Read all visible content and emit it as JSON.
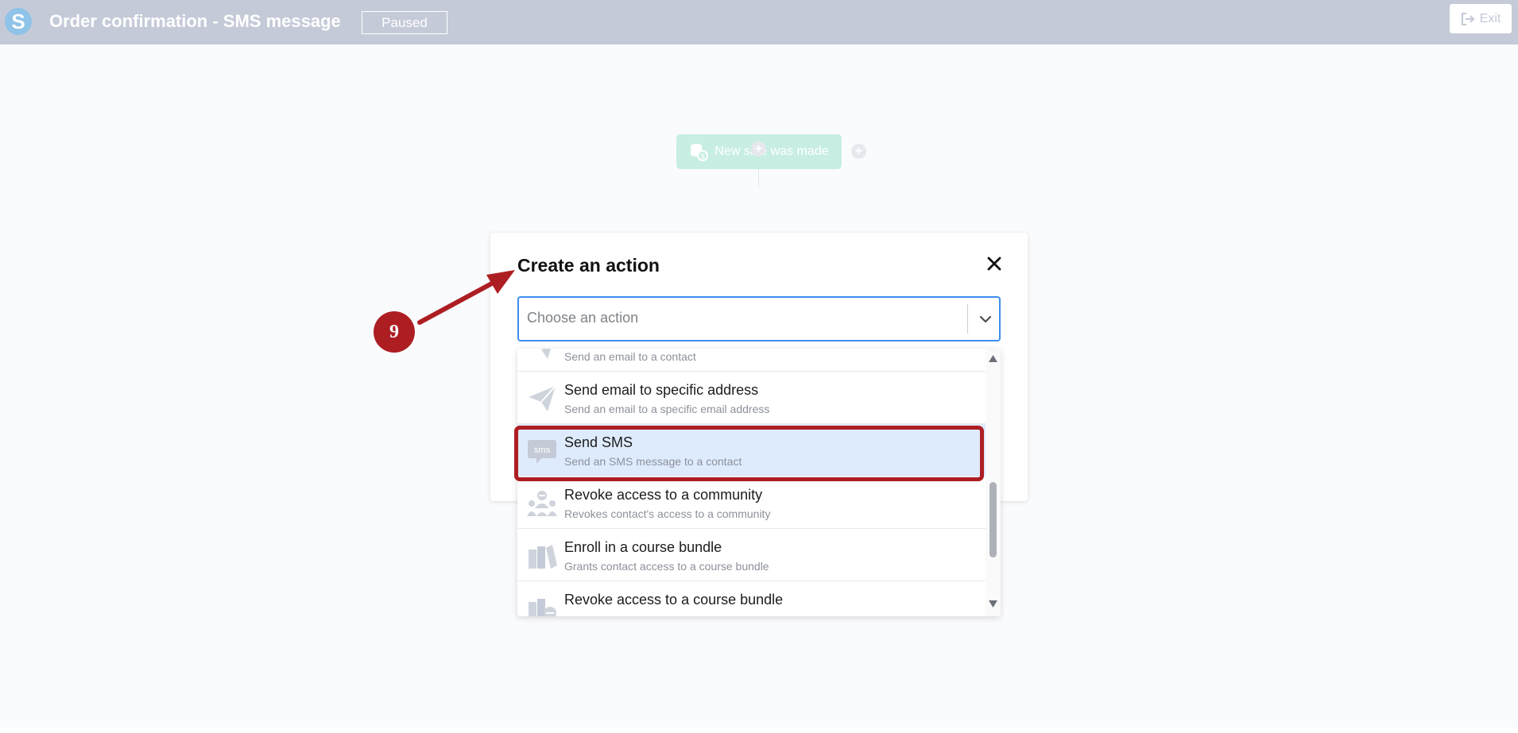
{
  "header": {
    "title": "Order confirmation - SMS message",
    "status": "Paused",
    "exit_label": "Exit"
  },
  "canvas": {
    "trigger_label": "New sale was made"
  },
  "modal": {
    "title": "Create an action",
    "select_placeholder": "Choose an action"
  },
  "menu": {
    "items": [
      {
        "label": "",
        "desc": "Send an email to a contact",
        "icon": "paper-plane-icon"
      },
      {
        "label": "Send email to specific address",
        "desc": "Send an email to a specific email address",
        "icon": "paper-plane-icon"
      },
      {
        "label": "Send SMS",
        "desc": "Send an SMS message to a contact",
        "icon": "sms-icon"
      },
      {
        "label": "Revoke access to a community",
        "desc": "Revokes contact's access to a community",
        "icon": "community-revoke-icon"
      },
      {
        "label": "Enroll in a course bundle",
        "desc": "Grants contact access to a course bundle",
        "icon": "course-bundle-icon"
      },
      {
        "label": "Revoke access to a course bundle",
        "desc": "",
        "icon": "course-bundle-revoke-icon"
      }
    ],
    "selected_index": 2
  },
  "annotation": {
    "step_number": "9"
  },
  "colors": {
    "accent": "#3d8ef0",
    "highlight": "#ad1e23",
    "header_bg": "#c5cad8",
    "trigger_bg": "#c8eee3",
    "selected_bg": "#deebfd"
  }
}
